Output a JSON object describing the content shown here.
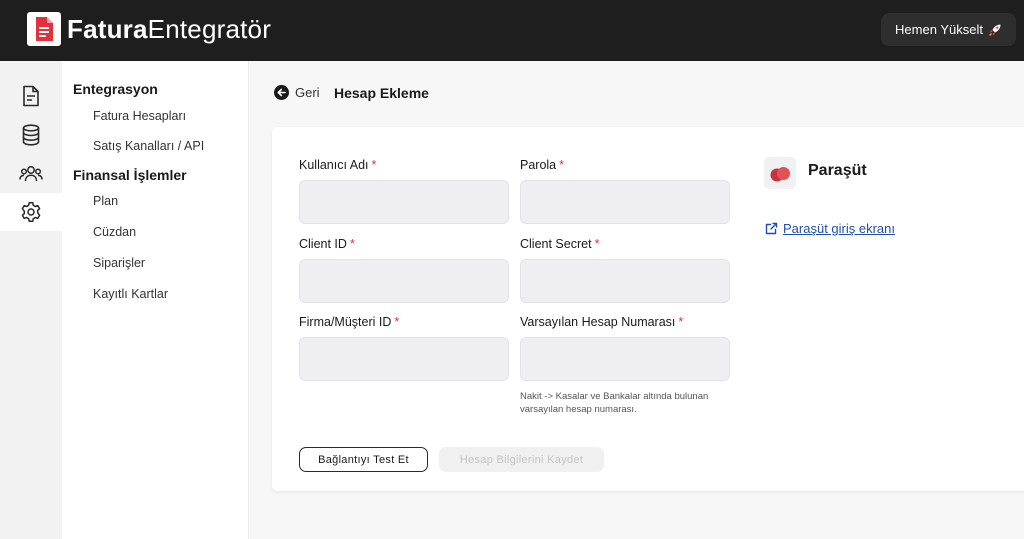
{
  "brand": {
    "name_bold": "Fatura",
    "name_light": "Entegratör"
  },
  "header": {
    "upgrade_label": "Hemen Yükselt"
  },
  "rail": {
    "icons": [
      "document-icon",
      "database-icon",
      "users-icon",
      "settings-icon"
    ],
    "active": "settings-icon"
  },
  "menu": {
    "section1": {
      "title": "Entegrasyon",
      "items": [
        "Fatura Hesapları",
        "Satış Kanalları / API"
      ]
    },
    "section2": {
      "title": "Finansal İşlemler",
      "items": [
        "Plan",
        "Cüzdan",
        "Siparişler",
        "Kayıtlı Kartlar"
      ]
    }
  },
  "page": {
    "back_label": "Geri",
    "title": "Hesap Ekleme"
  },
  "form": {
    "required_mark": "*",
    "fields": [
      {
        "label": "Kullanıcı Adı",
        "value": ""
      },
      {
        "label": "Parola",
        "value": ""
      },
      {
        "label": "Client ID",
        "value": ""
      },
      {
        "label": "Client Secret",
        "value": ""
      },
      {
        "label": "Firma/Müşteri ID",
        "value": ""
      },
      {
        "label": "Varsayılan Hesap Numarası",
        "value": ""
      }
    ],
    "hint": "Nakit -> Kasalar ve Bankalar altında bulunan varsayılan hesap numarası.",
    "test_button": "Bağlantıyı Test Et",
    "save_button": "Hesap Bilgilerini Kaydet"
  },
  "provider": {
    "name": "Paraşüt",
    "login_link": "Paraşüt giriş ekranı"
  },
  "colors": {
    "topbar": "#1e1e1e",
    "required": "#d93636",
    "link": "#1f4fa8",
    "brand_red": "#e0313d"
  }
}
